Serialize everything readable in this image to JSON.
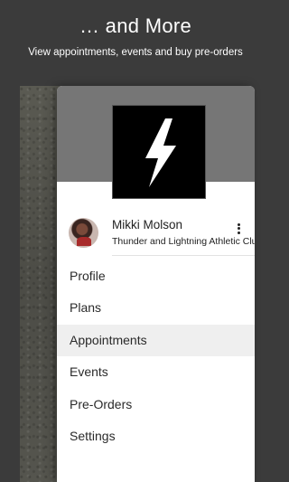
{
  "promo": {
    "title": "… and More",
    "subtitle": "View appointments, events and buy pre-orders"
  },
  "drawer": {
    "logo": "lightning-bolt-logo",
    "user": {
      "name": "Mikki Molson",
      "club": "Thunder and Lightning Athletic Club"
    },
    "menu": [
      {
        "label": "Profile",
        "active": false
      },
      {
        "label": "Plans",
        "active": false
      },
      {
        "label": "Appointments",
        "active": true
      },
      {
        "label": "Events",
        "active": false
      },
      {
        "label": "Pre-Orders",
        "active": false
      },
      {
        "label": "Settings",
        "active": false
      }
    ]
  },
  "colors": {
    "background": "#3b3b3b",
    "header": "#767676",
    "active_item": "#efefef"
  }
}
